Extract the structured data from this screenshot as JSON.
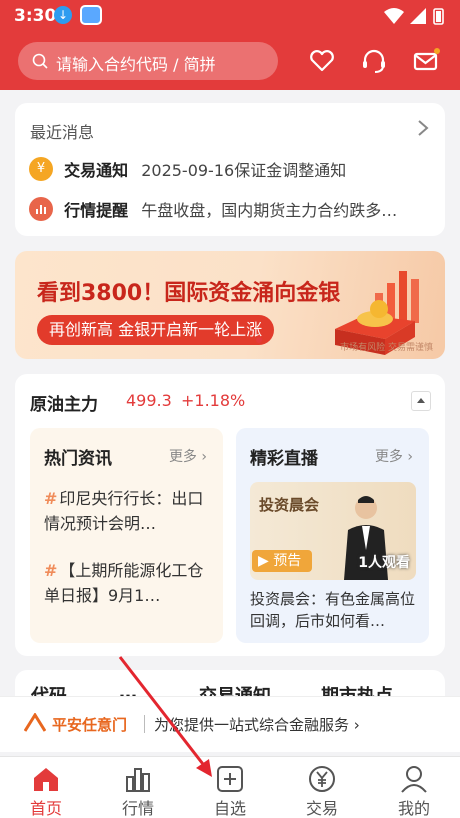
{
  "status_bar": {
    "time": "3:30"
  },
  "search": {
    "placeholder": "请输入合约代码 / 简拼"
  },
  "news": {
    "title": "最近消息",
    "items": [
      {
        "badge": "¥",
        "label": "交易通知",
        "text": "2025-09-16保证金调整通知"
      },
      {
        "badge": "📊",
        "label": "行情提醒",
        "text": "午盘收盘，国内期货主力合约跌多…"
      }
    ]
  },
  "banner": {
    "headline": "看到3800！国际资金涌向金银",
    "pill": "再创新高 金银开启新一轮上涨",
    "risk": "市场有风险 交易需谨慎"
  },
  "market": {
    "name": "原油主力",
    "price": "499.3",
    "change": "+1.18%",
    "hot": {
      "title": "热门资讯",
      "more": "更多",
      "items": [
        "印尼央行行长：出口情况预计会明…",
        "【上期所能源化工仓单日报】9月1…"
      ]
    },
    "live": {
      "title": "精彩直播",
      "more": "更多",
      "thumb_title": "投资晨会",
      "preview": "预告",
      "viewers": "1人观看",
      "desc": "投资晨会：有色金属高位回调，后市如何看…"
    }
  },
  "tabs_peek": [
    "代码",
    "…",
    "交易通知",
    "期市热点"
  ],
  "promo": {
    "brand": "平安任意门",
    "message": "为您提供一站式综合金融服务 ›"
  },
  "tabbar": [
    {
      "label": "首页",
      "active": true
    },
    {
      "label": "行情",
      "active": false
    },
    {
      "label": "自选",
      "active": false
    },
    {
      "label": "交易",
      "active": false
    },
    {
      "label": "我的",
      "active": false
    }
  ],
  "colors": {
    "primary": "#e33b3b",
    "accent": "#f0a63a"
  }
}
